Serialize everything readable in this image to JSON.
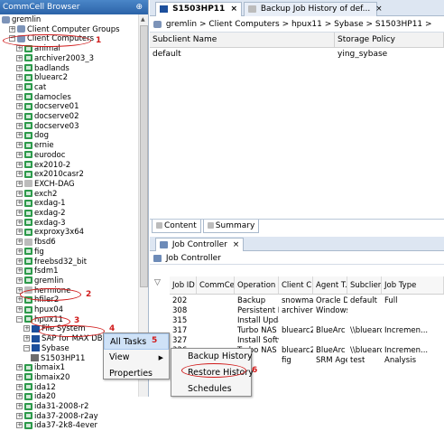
{
  "left_panel": {
    "title": "CommCell Browser",
    "tree": [
      {
        "label": "gremlin",
        "icon": "commcell-icon",
        "indent": 0,
        "exp": ""
      },
      {
        "label": "Client Computer Groups",
        "icon": "client-group-icon",
        "indent": 1,
        "exp": "+"
      },
      {
        "label": "Client Computers",
        "icon": "client-computers-icon",
        "indent": 1,
        "exp": "-"
      },
      {
        "label": "animal",
        "icon": "client-icon",
        "indent": 2,
        "exp": "+"
      },
      {
        "label": "archiver2003_3",
        "icon": "client-icon",
        "indent": 2,
        "exp": "+"
      },
      {
        "label": "badlands",
        "icon": "client-icon",
        "indent": 2,
        "exp": "+"
      },
      {
        "label": "bluearc2",
        "icon": "client-icon",
        "indent": 2,
        "exp": "+"
      },
      {
        "label": "cat",
        "icon": "client-icon",
        "indent": 2,
        "exp": "+"
      },
      {
        "label": "damocles",
        "icon": "client-icon",
        "indent": 2,
        "exp": "+"
      },
      {
        "label": "docserve01",
        "icon": "client-icon",
        "indent": 2,
        "exp": "+"
      },
      {
        "label": "docserve02",
        "icon": "client-icon",
        "indent": 2,
        "exp": "+"
      },
      {
        "label": "docserve03",
        "icon": "client-icon",
        "indent": 2,
        "exp": "+"
      },
      {
        "label": "dog",
        "icon": "client-icon",
        "indent": 2,
        "exp": "+"
      },
      {
        "label": "ernie",
        "icon": "client-icon",
        "indent": 2,
        "exp": "+"
      },
      {
        "label": "eurodoc",
        "icon": "client-icon",
        "indent": 2,
        "exp": "+"
      },
      {
        "label": "ex2010-2",
        "icon": "client-icon",
        "indent": 2,
        "exp": "+"
      },
      {
        "label": "ex2010casr2",
        "icon": "client-icon",
        "indent": 2,
        "exp": "+"
      },
      {
        "label": "EXCH-DAG",
        "icon": "client-icon-gray",
        "indent": 2,
        "exp": "+"
      },
      {
        "label": "exch2",
        "icon": "client-icon",
        "indent": 2,
        "exp": "+"
      },
      {
        "label": "exdag-1",
        "icon": "client-icon",
        "indent": 2,
        "exp": "+"
      },
      {
        "label": "exdag-2",
        "icon": "client-icon",
        "indent": 2,
        "exp": "+"
      },
      {
        "label": "exdag-3",
        "icon": "client-icon",
        "indent": 2,
        "exp": "+"
      },
      {
        "label": "exproxy3x64",
        "icon": "client-icon",
        "indent": 2,
        "exp": "+"
      },
      {
        "label": "fbsd6",
        "icon": "client-icon-gray",
        "indent": 2,
        "exp": "+"
      },
      {
        "label": "fig",
        "icon": "client-icon",
        "indent": 2,
        "exp": "+"
      },
      {
        "label": "freebsd32_bit",
        "icon": "client-icon",
        "indent": 2,
        "exp": "+"
      },
      {
        "label": "fsdm1",
        "icon": "client-icon",
        "indent": 2,
        "exp": "+"
      },
      {
        "label": "gremlin",
        "icon": "client-icon",
        "indent": 2,
        "exp": "+"
      },
      {
        "label": "hermione",
        "icon": "client-icon-gray",
        "indent": 2,
        "exp": "+"
      },
      {
        "label": "hfiler2",
        "icon": "client-icon",
        "indent": 2,
        "exp": "+"
      },
      {
        "label": "hpux04",
        "icon": "client-icon",
        "indent": 2,
        "exp": "+"
      },
      {
        "label": "hpux11",
        "icon": "client-icon",
        "indent": 2,
        "exp": "-"
      },
      {
        "label": "File System",
        "icon": "agent-icon",
        "indent": 3,
        "exp": "+"
      },
      {
        "label": "SAP for MAX DB",
        "icon": "agent-icon",
        "indent": 3,
        "exp": "+"
      },
      {
        "label": "Sybase",
        "icon": "agent-icon",
        "indent": 3,
        "exp": "-"
      },
      {
        "label": "S1503HP11",
        "icon": "instance-icon",
        "indent": 4,
        "exp": ""
      },
      {
        "label": "ibmaix1",
        "icon": "client-icon",
        "indent": 2,
        "exp": "+"
      },
      {
        "label": "ibmaix20",
        "icon": "client-icon",
        "indent": 2,
        "exp": "+"
      },
      {
        "label": "ida12",
        "icon": "client-icon",
        "indent": 2,
        "exp": "+"
      },
      {
        "label": "ida20",
        "icon": "client-icon",
        "indent": 2,
        "exp": "+"
      },
      {
        "label": "ida31-2008-r2",
        "icon": "client-icon",
        "indent": 2,
        "exp": "+"
      },
      {
        "label": "ida37-2008-r2ay",
        "icon": "client-icon",
        "indent": 2,
        "exp": "+"
      },
      {
        "label": "ida37-2k8-4ever",
        "icon": "client-icon",
        "indent": 2,
        "exp": "+"
      }
    ]
  },
  "annotations": {
    "n1": "1",
    "n2": "2",
    "n3": "3",
    "n4": "4",
    "n5": "5",
    "n6": "6"
  },
  "tabs": {
    "tab1": "S1503HP11",
    "tab2": "Backup Job History of def...",
    "close": "×"
  },
  "breadcrumb": {
    "text": "gremlin > Client Computers > hpux11 > Sybase > S1503HP11 >"
  },
  "subclient_table": {
    "headers": [
      "Subclient Name",
      "Storage Policy"
    ],
    "rows": [
      [
        "default",
        "ying_sybase"
      ]
    ]
  },
  "subtabs": {
    "content": "Content",
    "summary": "Summary"
  },
  "job_controller": {
    "tab": "Job Controller",
    "title": "Job Controller",
    "headers": [
      "Job ID",
      "CommCell",
      "Operation",
      "Client C...",
      "Agent T...",
      "Subclient",
      "Job Type"
    ],
    "rows": [
      [
        "202",
        "",
        "Backup",
        "snowman",
        "Oracle D...",
        "default",
        "Full"
      ],
      [
        "308",
        "",
        "Persistent R...",
        "archiver2...",
        "Windows...",
        "",
        ""
      ],
      [
        "315",
        "",
        "Install Updates",
        "",
        "",
        "",
        ""
      ],
      [
        "317",
        "",
        "Turbo NAS",
        "bluearc2",
        "BlueArc N...",
        "\\\\bluearc...",
        "Incremen..."
      ],
      [
        "327",
        "",
        "Install Softw...",
        "",
        "",
        "",
        ""
      ],
      [
        "326",
        "",
        "Turbo NAS",
        "bluearc2",
        "BlueArc N...",
        "\\\\bluearc...",
        "Incremen..."
      ],
      [
        "",
        "",
        "",
        "fig",
        "SRM Age...",
        "test",
        "Analysis"
      ]
    ]
  },
  "context_menu": {
    "items": [
      "All Tasks",
      "View",
      "Properties"
    ]
  },
  "submenu": {
    "items": [
      "Backup History",
      "Restore History",
      "Schedules"
    ]
  }
}
